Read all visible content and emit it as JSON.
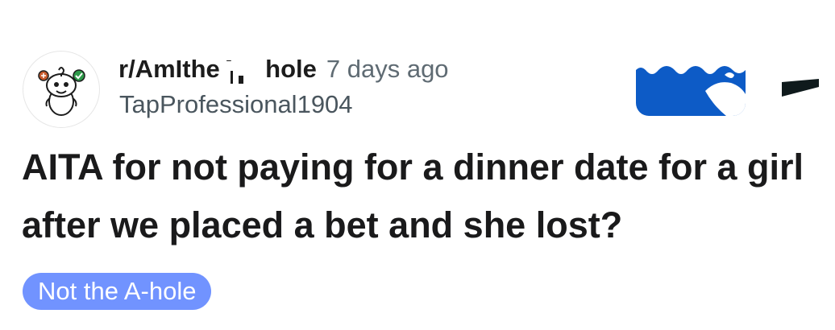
{
  "post": {
    "subreddit": "r/AmItheA",
    "subreddit_tail": "hole",
    "time_ago": "7 days ago",
    "author": "TapProfessional1904",
    "title": "AITA for not paying for a dinner date for a girl after we placed a bet and she lost?",
    "flair": "Not the A-hole",
    "avatar_icon": "snoo-avatar-icon",
    "join_button_icon": "join-button-icon",
    "more_menu_icon": "more-options-icon"
  },
  "colors": {
    "flair_background": "#7193ff",
    "join_button": "#0d5bc6",
    "title_text": "#1a1a1b",
    "meta_text": "#5f6b73"
  }
}
